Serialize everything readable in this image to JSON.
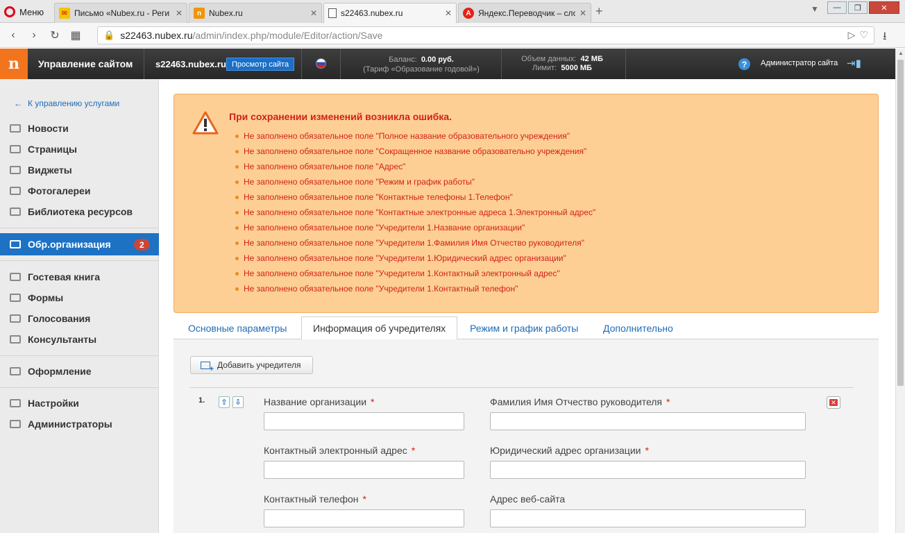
{
  "browser": {
    "menu_label": "Меню",
    "tabs": [
      {
        "title": "Письмо «Nubex.ru - Реги",
        "icon": "mail-icon"
      },
      {
        "title": "Nubex.ru",
        "icon": "nubex-favicon"
      },
      {
        "title": "s22463.nubex.ru",
        "icon": "page-icon"
      },
      {
        "title": "Яндекс.Переводчик – сло",
        "icon": "yandex-icon"
      }
    ],
    "url_host": "s22463.nubex.ru",
    "url_path": "/admin/index.php/module/Editor/action/Save"
  },
  "header": {
    "logo": "n",
    "title": "Управление сайтом",
    "site": "s22463.nubex.ru",
    "view_button": "Просмотр сайта",
    "balance_label": "Баланс:",
    "balance_value": "0.00 руб.",
    "tariff": "(Тариф «Образование годовой»)",
    "volume_label": "Объем данных:",
    "volume_value": "42 МБ",
    "limit_label": "Лимит:",
    "limit_value": "5000 МБ",
    "help": "?",
    "admin": "Администратор сайта"
  },
  "sidebar": {
    "back": "К управлению услугами",
    "items": [
      {
        "label": "Новости"
      },
      {
        "label": "Страницы"
      },
      {
        "label": "Виджеты"
      },
      {
        "label": "Фотогалереи"
      },
      {
        "label": "Библиотека ресурсов"
      }
    ],
    "active": {
      "label": "Обр.организация",
      "badge": "2"
    },
    "items2": [
      {
        "label": "Гостевая книга"
      },
      {
        "label": "Формы"
      },
      {
        "label": "Голосования"
      },
      {
        "label": "Консультанты"
      }
    ],
    "items3": [
      {
        "label": "Оформление"
      }
    ],
    "items4": [
      {
        "label": "Настройки"
      },
      {
        "label": "Администраторы"
      }
    ]
  },
  "alert": {
    "title": "При сохранении изменений возникла ошибка.",
    "errors": [
      "Не заполнено обязательное поле \"Полное название образовательного учреждения\"",
      "Не заполнено обязательное поле \"Сокращенное название образовательно учреждения\"",
      "Не заполнено обязательное поле \"Адрес\"",
      "Не заполнено обязательное поле \"Режим и график работы\"",
      "Не заполнено обязательное поле \"Контактные телефоны 1.Телефон\"",
      "Не заполнено обязательное поле \"Контактные электронные адреса 1.Электронный адрес\"",
      "Не заполнено обязательное поле \"Учредители 1.Название организации\"",
      "Не заполнено обязательное поле \"Учредители 1.Фамилия Имя Отчество руководителя\"",
      "Не заполнено обязательное поле \"Учредители 1.Юридический адрес организации\"",
      "Не заполнено обязательное поле \"Учредители 1.Контактный электронный адрес\"",
      "Не заполнено обязательное поле \"Учредители 1.Контактный телефон\""
    ]
  },
  "tabs": [
    {
      "label": "Основные параметры"
    },
    {
      "label": "Информация об учредителях"
    },
    {
      "label": "Режим и график работы"
    },
    {
      "label": "Дополнительно"
    }
  ],
  "form": {
    "add_button": "Добавить учредителя",
    "item_number": "1.",
    "required_mark": "*",
    "fields": {
      "org_name": {
        "label": "Название организации",
        "value": ""
      },
      "head_name": {
        "label": "Фамилия Имя Отчество руководителя",
        "value": ""
      },
      "email": {
        "label": "Контактный электронный адрес",
        "value": ""
      },
      "legal_address": {
        "label": "Юридический адрес организации",
        "value": ""
      },
      "phone": {
        "label": "Контактный телефон",
        "value": ""
      },
      "website": {
        "label": "Адрес веб-сайта",
        "value": ""
      }
    }
  }
}
